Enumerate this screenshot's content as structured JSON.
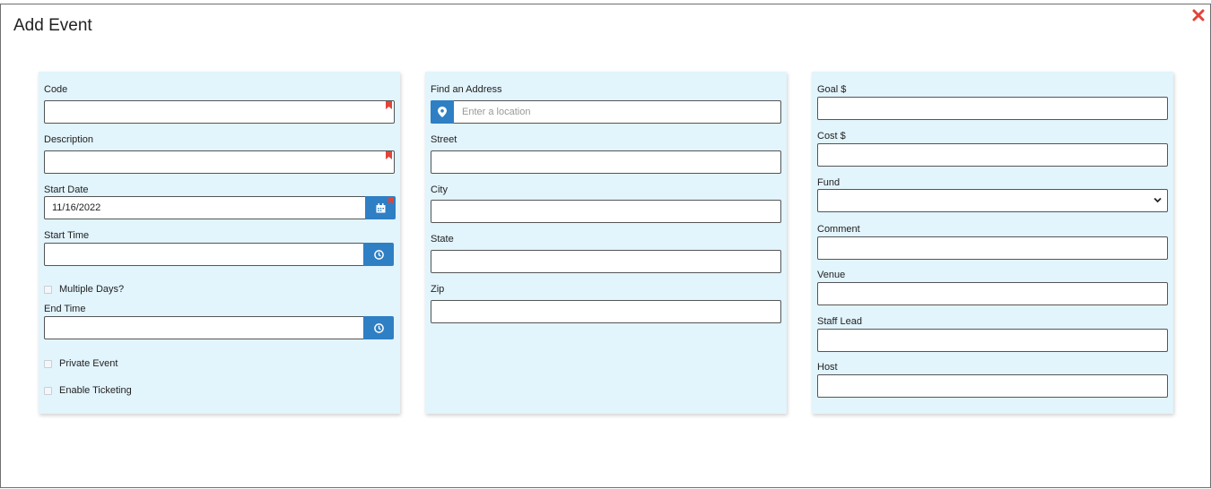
{
  "modal": {
    "title": "Add Event",
    "close_icon": "close-icon",
    "accent_color": "#2f7fc4",
    "required_color": "#e0443a"
  },
  "left_panel": {
    "code": {
      "label": "Code",
      "value": ""
    },
    "description": {
      "label": "Description",
      "value": ""
    },
    "start_date": {
      "label": "Start Date",
      "value": "11/16/2022"
    },
    "start_time": {
      "label": "Start Time",
      "value": ""
    },
    "multiple_days": {
      "label": "Multiple Days?",
      "checked": false
    },
    "end_time": {
      "label": "End Time",
      "value": ""
    },
    "private_event": {
      "label": "Private Event",
      "checked": false
    },
    "enable_ticketing": {
      "label": "Enable Ticketing",
      "checked": false
    }
  },
  "middle_panel": {
    "find_address": {
      "label": "Find an Address",
      "placeholder": "Enter a location"
    },
    "street": {
      "label": "Street",
      "value": ""
    },
    "city": {
      "label": "City",
      "value": ""
    },
    "state": {
      "label": "State",
      "value": ""
    },
    "zip": {
      "label": "Zip",
      "value": ""
    }
  },
  "right_panel": {
    "goal": {
      "label": "Goal $",
      "value": ""
    },
    "cost": {
      "label": "Cost $",
      "value": ""
    },
    "fund": {
      "label": "Fund",
      "selected": ""
    },
    "comment": {
      "label": "Comment",
      "value": ""
    },
    "venue": {
      "label": "Venue",
      "value": ""
    },
    "staff_lead": {
      "label": "Staff Lead",
      "value": ""
    },
    "host": {
      "label": "Host",
      "value": ""
    }
  }
}
